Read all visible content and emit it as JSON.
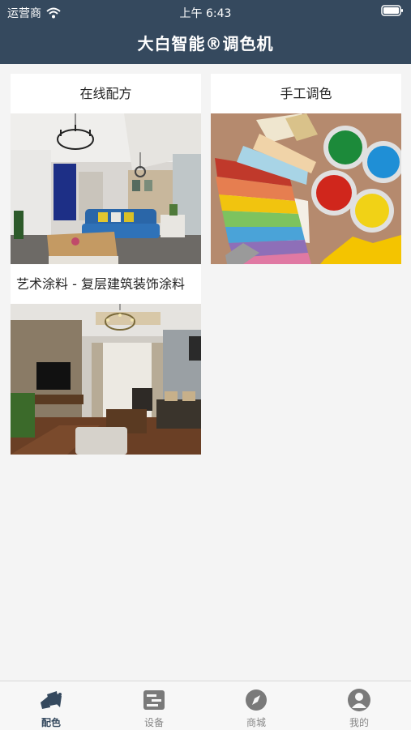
{
  "status_bar": {
    "carrier": "运营商",
    "time": "上午 6:43"
  },
  "header": {
    "title": "大白智能®调色机"
  },
  "cards": [
    {
      "label": "在线配方",
      "image": "living-room-blue-sofa"
    },
    {
      "label": "手工调色",
      "image": "paint-swatches-and-cans"
    },
    {
      "label": "艺术涂料 - 复层建筑装饰涂料",
      "image": "living-room-wood-floor"
    }
  ],
  "tabs": [
    {
      "label": "配色",
      "icon": "palette-icon",
      "active": true
    },
    {
      "label": "设备",
      "icon": "device-icon",
      "active": false
    },
    {
      "label": "商城",
      "icon": "compass-icon",
      "active": false
    },
    {
      "label": "我的",
      "icon": "user-icon",
      "active": false
    }
  ],
  "colors": {
    "header": "#35495e",
    "background": "#f4f4f4",
    "tab_active": "#35495e",
    "tab_inactive": "#888888"
  }
}
